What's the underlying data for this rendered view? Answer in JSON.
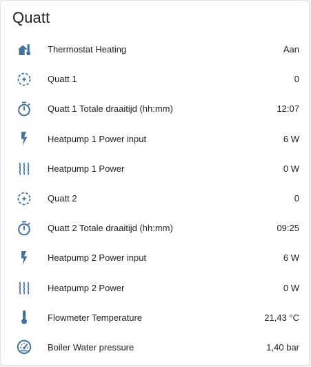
{
  "card": {
    "title": "Quatt"
  },
  "icon_color": "#44739e",
  "rows": [
    {
      "icon": "home-thermometer-icon",
      "label": "Thermostat Heating",
      "value": "Aan"
    },
    {
      "icon": "circle-spin-icon",
      "label": "Quatt 1",
      "value": "0"
    },
    {
      "icon": "timer-icon",
      "label": "Quatt 1 Totale draaitijd (hh:mm)",
      "value": "12:07"
    },
    {
      "icon": "flash-icon",
      "label": "Heatpump 1 Power input",
      "value": "6 W"
    },
    {
      "icon": "heat-waves-icon",
      "label": "Heatpump 1 Power",
      "value": "0 W"
    },
    {
      "icon": "circle-spin-icon",
      "label": "Quatt 2",
      "value": "0"
    },
    {
      "icon": "timer-icon",
      "label": "Quatt 2 Totale draaitijd (hh:mm)",
      "value": "09:25"
    },
    {
      "icon": "flash-icon",
      "label": "Heatpump 2 Power input",
      "value": "6 W"
    },
    {
      "icon": "heat-waves-icon",
      "label": "Heatpump 2 Power",
      "value": "0 W"
    },
    {
      "icon": "thermometer-icon",
      "label": "Flowmeter Temperature",
      "value": "21,43 °C"
    },
    {
      "icon": "gauge-icon",
      "label": "Boiler Water pressure",
      "value": "1,40 bar"
    }
  ]
}
